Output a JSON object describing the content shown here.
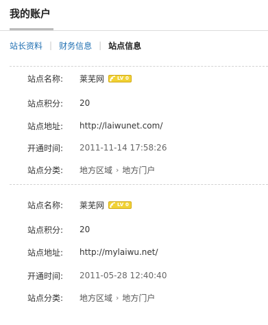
{
  "header": {
    "title": "我的账户"
  },
  "tabs": [
    {
      "label": "站长资料",
      "active": false
    },
    {
      "label": "财务信息",
      "active": false
    },
    {
      "label": "站点信息",
      "active": true
    }
  ],
  "tab_separator": "|",
  "labels": {
    "name": "站点名称:",
    "points": "站点积分:",
    "url": "站点地址:",
    "opened": "开通时间:",
    "category": "站点分类:"
  },
  "sites": [
    {
      "name": "莱芜网",
      "level_badge": "LV 0",
      "points": "20",
      "url": "http://laiwunet.com/",
      "opened": "2011-11-14 17:58:26",
      "category_parent": "地方区域",
      "category_child": "地方门户"
    },
    {
      "name": "莱芜网",
      "level_badge": "LV 0",
      "points": "20",
      "url": "http://mylaiwu.net/",
      "opened": "2011-05-28 12:40:40",
      "category_parent": "地方区域",
      "category_child": "地方门户"
    }
  ],
  "colors": {
    "link": "#1f6fb2",
    "badge": "#f1d235",
    "divider": "#d2d2d2"
  },
  "icons": {
    "level": "signal-icon",
    "breadcrumb": "chevron-right-icon"
  }
}
